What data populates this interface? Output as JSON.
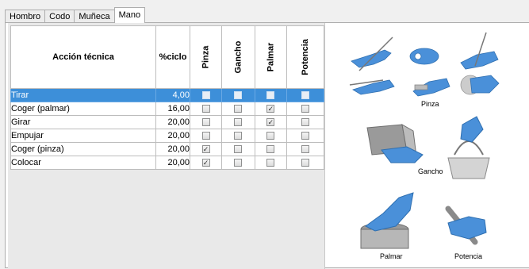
{
  "tabs": [
    {
      "label": "Hombro",
      "active": false
    },
    {
      "label": "Codo",
      "active": false
    },
    {
      "label": "Muñeca",
      "active": false
    },
    {
      "label": "Mano",
      "active": true
    }
  ],
  "table": {
    "headers": {
      "action": "Acción técnica",
      "pct": "%ciclo",
      "pinza": "Pinza",
      "gancho": "Gancho",
      "palmar": "Palmar",
      "potencia": "Potencia"
    },
    "rows": [
      {
        "name": "Tirar",
        "pct": "4,00",
        "pinza": false,
        "gancho": false,
        "palmar": false,
        "potencia": false,
        "selected": true
      },
      {
        "name": "Coger (palmar)",
        "pct": "16,00",
        "pinza": false,
        "gancho": false,
        "palmar": true,
        "potencia": false,
        "selected": false
      },
      {
        "name": "Girar",
        "pct": "20,00",
        "pinza": false,
        "gancho": false,
        "palmar": true,
        "potencia": false,
        "selected": false
      },
      {
        "name": "Empujar",
        "pct": "20,00",
        "pinza": false,
        "gancho": false,
        "palmar": false,
        "potencia": false,
        "selected": false
      },
      {
        "name": "Coger (pinza)",
        "pct": "20,00",
        "pinza": true,
        "gancho": false,
        "palmar": false,
        "potencia": false,
        "selected": false
      },
      {
        "name": "Colocar",
        "pct": "20,00",
        "pinza": true,
        "gancho": false,
        "palmar": false,
        "potencia": false,
        "selected": false
      }
    ]
  },
  "illustrations": {
    "pinza": "Pinza",
    "gancho": "Gancho",
    "palmar": "Palmar",
    "potencia": "Potencia"
  },
  "colors": {
    "selection": "#3d8fd9",
    "hand": "#4a90d9"
  }
}
